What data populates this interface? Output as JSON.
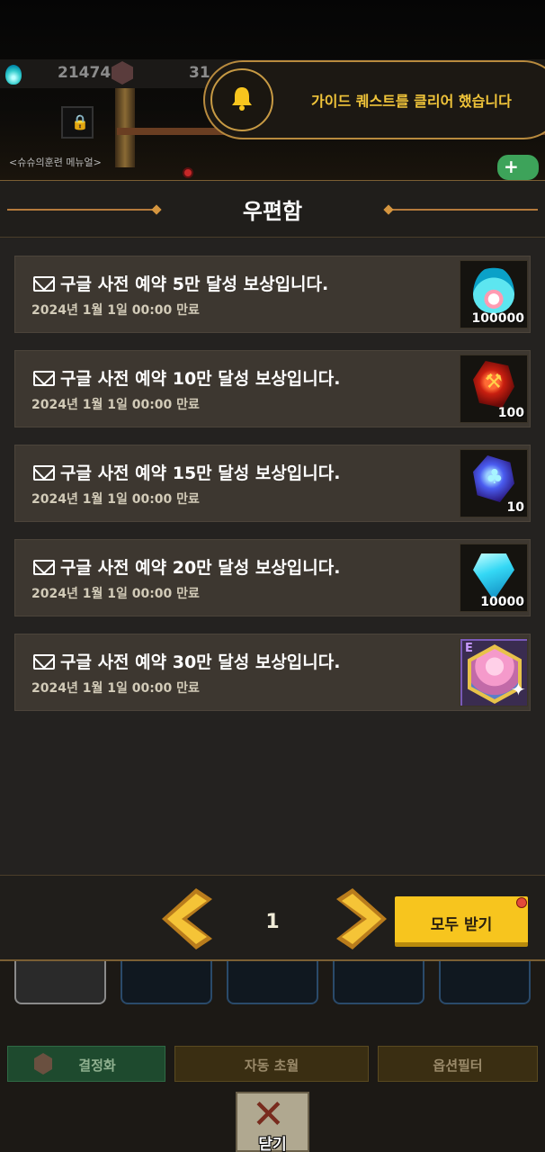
{
  "background": {
    "resource_left_value": "21474",
    "resource_right_value": "31",
    "manual_label": "<슈슈의훈련 메뉴얼>"
  },
  "toast": {
    "icon": "bell-icon",
    "message": "가이드 퀘스트를 클리어 했습니다"
  },
  "mailbox": {
    "title": "우편함",
    "items": [
      {
        "title": "구글 사전 예약 5만 달성 보상입니다.",
        "expiry": "2024년 1월 1일 00:00 만료",
        "reward_icon": "flame-icon",
        "reward_count": "100000"
      },
      {
        "title": "구글 사전 예약 10만 달성 보상입니다.",
        "expiry": "2024년 1월 1일 00:00 만료",
        "reward_icon": "red-rune-icon",
        "reward_count": "100"
      },
      {
        "title": "구글 사전 예약 15만 달성 보상입니다.",
        "expiry": "2024년 1월 1일 00:00 만료",
        "reward_icon": "blue-rune-icon",
        "reward_count": "10"
      },
      {
        "title": "구글 사전 예약 20만 달성 보상입니다.",
        "expiry": "2024년 1월 1일 00:00 만료",
        "reward_icon": "diamond-icon",
        "reward_count": "10000"
      },
      {
        "title": "구글 사전 예약 30만 달성 보상입니다.",
        "expiry": "2024년 1월 1일 00:00 만료",
        "reward_icon": "hero-portrait-icon",
        "reward_grade": "E"
      }
    ],
    "pagination": {
      "current_page": "1"
    },
    "claim_all_label": "모두 받기"
  },
  "bottom_tabs": {
    "crystallize": "결정화",
    "auto_transcend": "자동 초월",
    "option_filter": "옵션필터"
  },
  "close": {
    "label": "닫기"
  },
  "colors": {
    "accent_gold": "#f7c51e",
    "toast_text": "#f0c43a",
    "panel_bg": "#242220",
    "item_bg": "#3d3730"
  }
}
